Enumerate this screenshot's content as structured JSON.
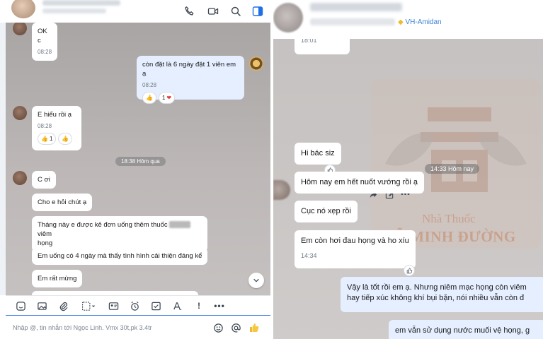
{
  "left": {
    "header": {
      "icons": [
        "phone-icon",
        "video-call-icon",
        "search-icon",
        "panel-toggle-icon"
      ]
    },
    "messages": [
      {
        "text": "OK c",
        "time": "08:28"
      },
      {
        "text": "còn đặt là 6 ngày đặt 1 viên em ạ",
        "time": "08:28",
        "reactions": [
          "1"
        ]
      },
      {
        "text": "E hiểu rồi ạ",
        "time": "08:28",
        "reactions": [
          "1"
        ]
      },
      {
        "text": "C ơi"
      },
      {
        "text": "Cho e hỏi chút ạ"
      },
      {
        "text_before": "Tháng này e được kê đơn uống thêm thuốc",
        "text_after": "viêm",
        "text_line2": "họng"
      },
      {
        "text": "Em uống có 4 ngày mà thấy tình hình cải thiện đáng kể"
      },
      {
        "text": "Em rất mừng"
      }
    ],
    "date_divider": "18:38 Hôm qua",
    "input": {
      "placeholder": "Nhập @, tin nhắn tới Ngọc Linh. Vmx 30t,pk 3.4tr"
    },
    "toolbar_icons": [
      "sticker-icon",
      "image-icon",
      "attachment-icon",
      "screenshot-icon",
      "contact-card-icon",
      "reminder-icon",
      "task-icon",
      "format-icon",
      "urgent-icon",
      "more-icon"
    ],
    "input_icons": [
      "emoji-icon",
      "mention-icon",
      "thumbs-up-icon"
    ]
  },
  "right": {
    "header": {
      "tag": "VH-Amidan"
    },
    "messages": [
      {
        "time": "18:01"
      },
      {
        "text": "Hi bác siz"
      },
      {
        "text": "Hôm nay em hết nuốt vướng rồi ạ"
      },
      {
        "text": "Cục nó xẹp rồi"
      },
      {
        "text": "Em còn hơi đau họng và ho xíu",
        "time": "14:34"
      },
      {
        "line1": "Vậy là tốt rồi em ạ. Nhưng niêm mạc họng còn viêm",
        "line2": "hay tiếp xúc không khí bụi bặn, nói nhiều vẫn còn đ"
      },
      {
        "text": "em vẫn sử dụng nước muối vệ họng, g"
      }
    ],
    "date_divider": "14:33 Hôm nay",
    "watermark": {
      "line1": "Nhà Thuốc",
      "line2": "ĐỖ MINH ĐƯỜNG"
    },
    "hover_actions": [
      "quote-icon",
      "forward-icon",
      "edit-icon",
      "more-icon"
    ]
  }
}
